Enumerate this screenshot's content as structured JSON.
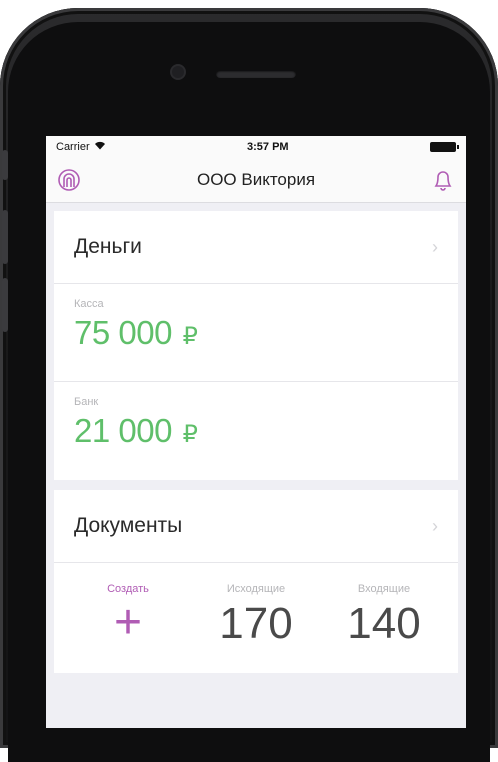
{
  "status": {
    "carrier": "Carrier",
    "time": "3:57 PM"
  },
  "nav": {
    "title": "ООО Виктория"
  },
  "money": {
    "title": "Деньги",
    "cash": {
      "label": "Касса",
      "amount": "75 000",
      "currency": "₽"
    },
    "bank": {
      "label": "Банк",
      "amount": "21 000",
      "currency": "₽"
    }
  },
  "documents": {
    "title": "Документы",
    "create_label": "Создать",
    "outgoing": {
      "label": "Исходящие",
      "count": "170"
    },
    "incoming": {
      "label": "Входящие",
      "count": "140"
    }
  },
  "colors": {
    "accent": "#b05cb4",
    "money": "#5fbf6a"
  },
  "icons": [
    "profile-icon",
    "bell-icon",
    "chevron-right-icon",
    "plus-icon",
    "wifi-icon",
    "battery-icon"
  ]
}
